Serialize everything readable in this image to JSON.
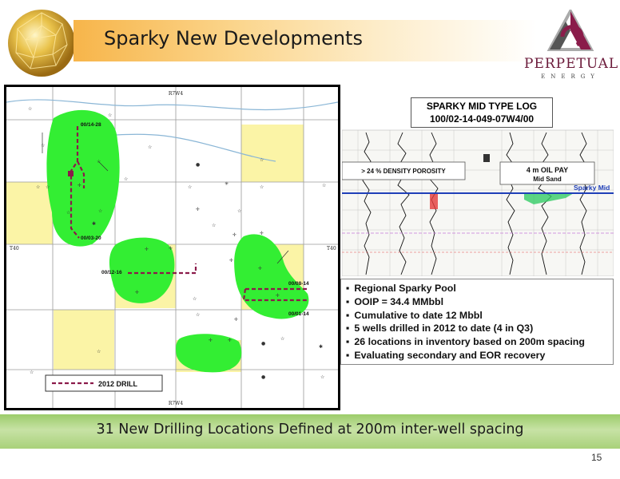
{
  "slide": {
    "title": "Sparky New Developments",
    "footer": "31 New Drilling Locations Defined at 200m inter-well spacing",
    "page_number": "15"
  },
  "logo": {
    "name": "PERPETUAL",
    "sub": "ENERGY"
  },
  "map": {
    "range_label_top": "R7W4",
    "range_label_bottom": "R7W4",
    "township_label_left": "T40",
    "township_label_right": "T40",
    "wells": [
      "00/14-28",
      "00/03-20",
      "00/12-16",
      "00/08-14",
      "00/01-14"
    ],
    "legend": "2012 DRILL",
    "colors": {
      "pool": "#33ee33",
      "lease": "#fbf4a6",
      "drill": "#8b1a4a"
    }
  },
  "type_log": {
    "title_line1": "SPARKY MID TYPE LOG",
    "title_line2": "100/02-14-049-07W4/00",
    "porosity_label": "> 24 % DENSITY POROSITY",
    "pay_line1": "4 m  OIL PAY",
    "pay_line2": "Mid Sand",
    "marker": "Sparky Mid"
  },
  "bullets": [
    "Regional Sparky Pool",
    "OOIP = 34.4 MMbbl",
    "Cumulative to date 12 Mbbl",
    "5 wells drilled in 2012 to date (4 in Q3)",
    "26 locations in inventory based on 200m spacing",
    "Evaluating secondary and EOR recovery"
  ]
}
